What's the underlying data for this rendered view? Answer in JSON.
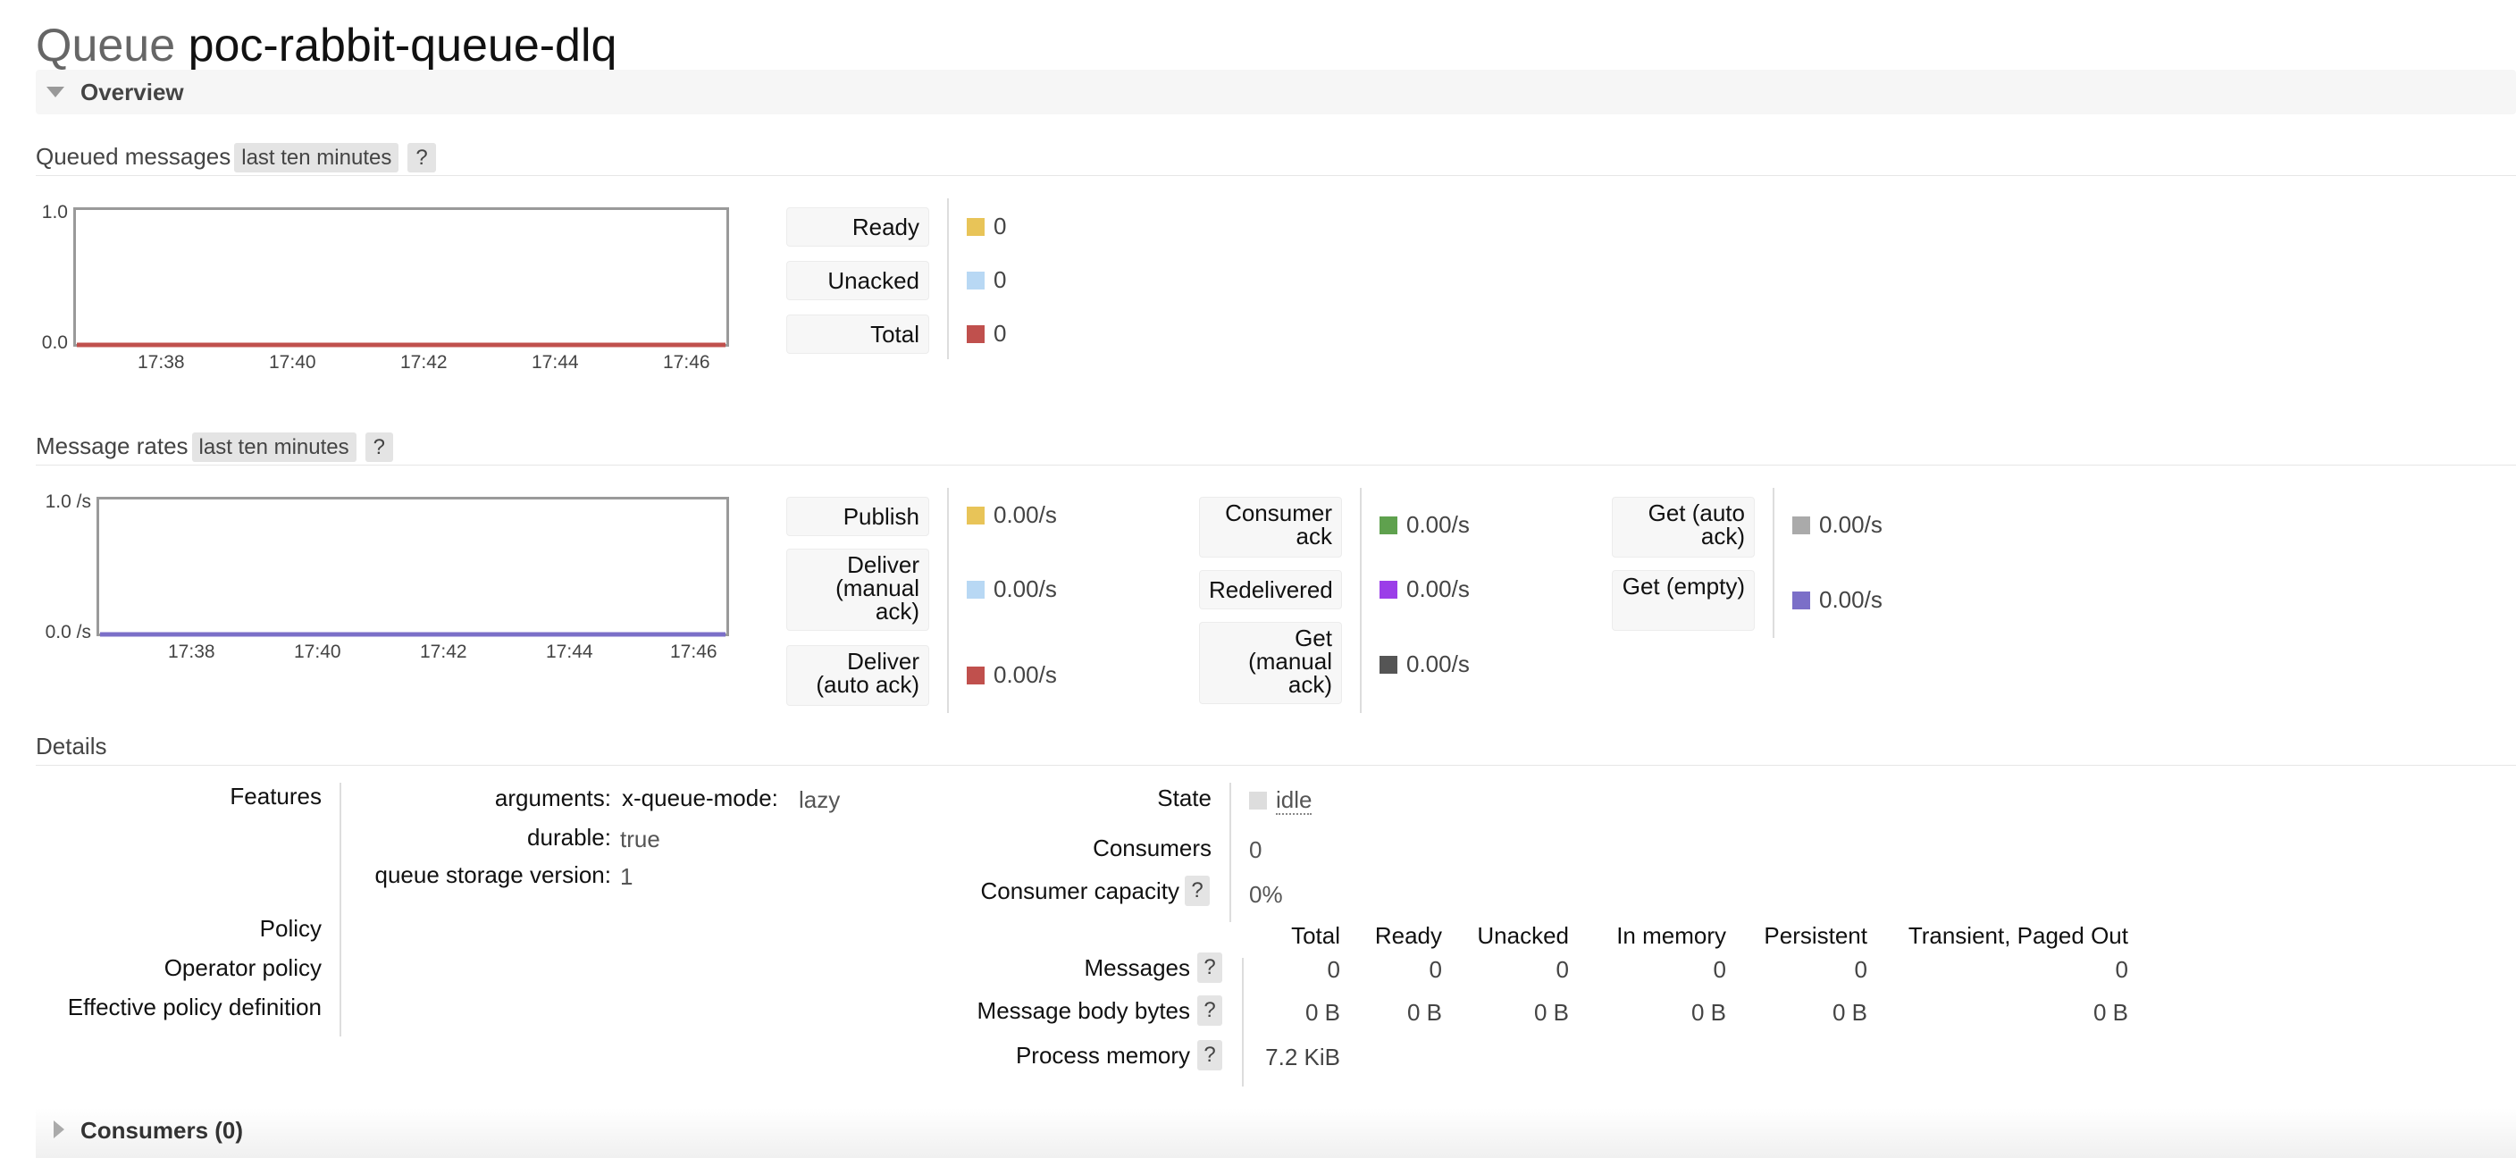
{
  "title": {
    "prefix": "Queue",
    "name": "poc-rabbit-queue-dlq"
  },
  "overview": {
    "label": "Overview"
  },
  "queued": {
    "title": "Queued messages",
    "range": "last ten minutes",
    "help": "?",
    "chart_data": {
      "type": "line",
      "title": "",
      "ylim": [
        0,
        1.0
      ],
      "ytick_labels": [
        "0.0",
        "1.0"
      ],
      "x": [
        "17:38",
        "17:40",
        "17:42",
        "17:44",
        "17:46"
      ],
      "series": [
        {
          "name": "Total",
          "values": [
            0,
            0,
            0,
            0,
            0
          ]
        }
      ],
      "grid": false
    },
    "legend": [
      {
        "label": "Ready",
        "value": "0",
        "color": "#e8c458"
      },
      {
        "label": "Unacked",
        "value": "0",
        "color": "#b8d8f4"
      },
      {
        "label": "Total",
        "value": "0",
        "color": "#c0504d"
      }
    ]
  },
  "rates": {
    "title": "Message rates",
    "range": "last ten minutes",
    "help": "?",
    "chart_data": {
      "type": "line",
      "title": "",
      "ylim": [
        0,
        1.0
      ],
      "ytick_labels": [
        "0.0 /s",
        "1.0 /s"
      ],
      "x": [
        "17:38",
        "17:40",
        "17:42",
        "17:44",
        "17:46"
      ],
      "series": [
        {
          "name": "Get (empty)",
          "values": [
            0,
            0,
            0,
            0,
            0
          ]
        }
      ],
      "grid": false
    },
    "col1": [
      {
        "label": "Publish",
        "value": "0.00/s",
        "color": "#e8c458"
      },
      {
        "label": "Deliver (manual ack)",
        "value": "0.00/s",
        "color": "#b8d8f4"
      },
      {
        "label": "Deliver (auto ack)",
        "value": "0.00/s",
        "color": "#c0504d"
      }
    ],
    "col2": [
      {
        "label": "Consumer ack",
        "value": "0.00/s",
        "color": "#5fa14e"
      },
      {
        "label": "Redelivered",
        "value": "0.00/s",
        "color": "#9b3ee8"
      },
      {
        "label": "Get (manual ack)",
        "value": "0.00/s",
        "color": "#555555"
      }
    ],
    "col3": [
      {
        "label": "Get (auto ack)",
        "value": "0.00/s",
        "color": "#aaaaaa"
      },
      {
        "label": "Get (empty)",
        "value": "0.00/s",
        "color": "#7b6fc8"
      }
    ]
  },
  "details": {
    "title": "Details",
    "features_label": "Features",
    "features": [
      {
        "key": "arguments:",
        "key2": "x-queue-mode:",
        "value": "lazy"
      },
      {
        "key": "durable:",
        "value": "true"
      },
      {
        "key": "queue storage version:",
        "value": "1"
      }
    ],
    "policy_label": "Policy",
    "operator_policy_label": "Operator policy",
    "effective_policy_label": "Effective policy definition",
    "state_label": "State",
    "state_value": "idle",
    "state_color": "#dddddd",
    "consumers_label": "Consumers",
    "consumers_value": "0",
    "capacity_label": "Consumer capacity",
    "capacity_value": "0%",
    "help": "?",
    "table": {
      "columns": [
        "Total",
        "Ready",
        "Unacked",
        "In memory",
        "Persistent",
        "Transient, Paged Out"
      ],
      "rows": [
        {
          "label": "Messages",
          "values": [
            "0",
            "0",
            "0",
            "0",
            "0",
            "0"
          ]
        },
        {
          "label": "Message body bytes",
          "values": [
            "0 B",
            "0 B",
            "0 B",
            "0 B",
            "0 B",
            "0 B"
          ]
        },
        {
          "label": "Process memory",
          "values": [
            "7.2 KiB"
          ]
        }
      ]
    }
  },
  "consumers_section": {
    "label": "Consumers (0)"
  }
}
